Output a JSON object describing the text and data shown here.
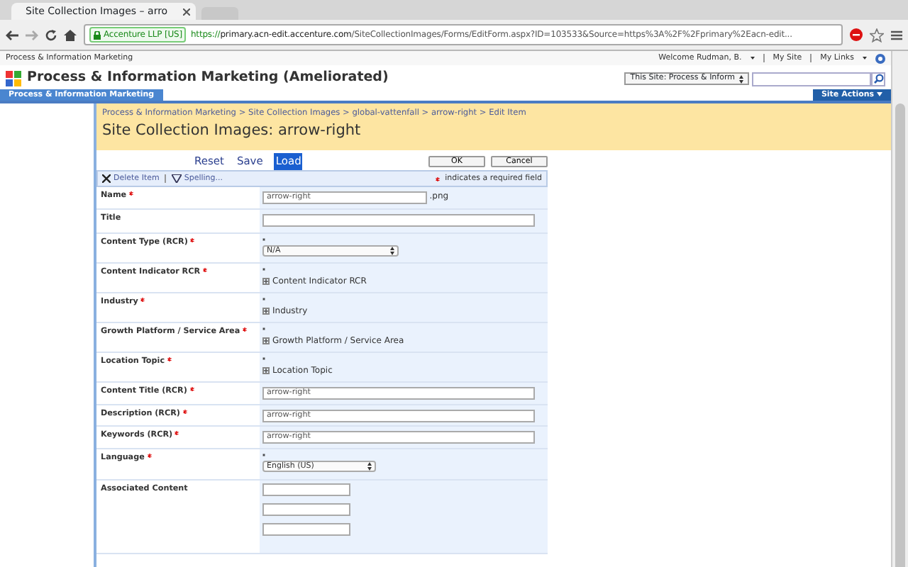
{
  "browser": {
    "tab_title": "Site Collection Images – arro",
    "cert_label": "Accenture LLP [US]",
    "url_scheme": "https://",
    "url_host": "primary.acn-edit.accenture.com",
    "url_path": "/SiteCollectionImages/Forms/EditForm.aspx?ID=103533&Source=https%3A%2F%2Fprimary%2Eacn-edit..."
  },
  "top_bar": {
    "site_link": "Process & Information Marketing",
    "welcome": "Welcome Rudman, B.",
    "my_site": "My Site",
    "my_links": "My Links"
  },
  "header": {
    "title": "Process & Information Marketing (Ameliorated)",
    "scope": "This Site: Process & Inform"
  },
  "nav": {
    "tabs": [
      {
        "label": "Process & Information Marketing",
        "selected": true
      }
    ],
    "site_actions": "Site Actions"
  },
  "breadcrumb": "Process & Information Marketing > Site Collection Images > global-vattenfall > arrow-right > Edit Item",
  "page_title": "Site Collection Images: arrow-right",
  "form_links": [
    {
      "label": "Reset",
      "selected": false
    },
    {
      "label": "Save",
      "selected": false
    },
    {
      "label": "Load",
      "selected": true
    }
  ],
  "buttons": [
    "OK",
    "Cancel"
  ],
  "toolbar": {
    "delete": "Delete Item",
    "spelling": "Spelling...",
    "required_note": "indicates a required field"
  },
  "fields": [
    {
      "label": "Name",
      "required": true,
      "kind": "text",
      "value": "arrow-right",
      "suffix": ".png"
    },
    {
      "label": "Title",
      "required": false,
      "kind": "text"
    },
    {
      "label": "Content Type (RCR)",
      "required": true,
      "kind": "select",
      "value": "N/A"
    },
    {
      "label": "Content Indicator RCR",
      "required": true,
      "kind": "picker",
      "value": "Content Indicator RCR"
    },
    {
      "label": "Industry",
      "required": true,
      "kind": "picker",
      "value": "Industry"
    },
    {
      "label": "Growth Platform / Service Area",
      "required": true,
      "kind": "picker",
      "value": "Growth Platform / Service Area"
    },
    {
      "label": "Location Topic",
      "required": true,
      "kind": "picker",
      "value": "Location Topic"
    },
    {
      "label": "Content Title (RCR)",
      "required": true,
      "kind": "text",
      "value": "arrow-right"
    },
    {
      "label": "Description (RCR)",
      "required": true,
      "kind": "text",
      "value": "arrow-right"
    },
    {
      "label": "Keywords (RCR)",
      "required": true,
      "kind": "text",
      "value": "arrow-right"
    },
    {
      "label": "Language",
      "required": true,
      "kind": "select",
      "value": "English (US)",
      "narrow": true
    },
    {
      "label": "Associated Content",
      "required": false,
      "kind": "multi"
    }
  ]
}
